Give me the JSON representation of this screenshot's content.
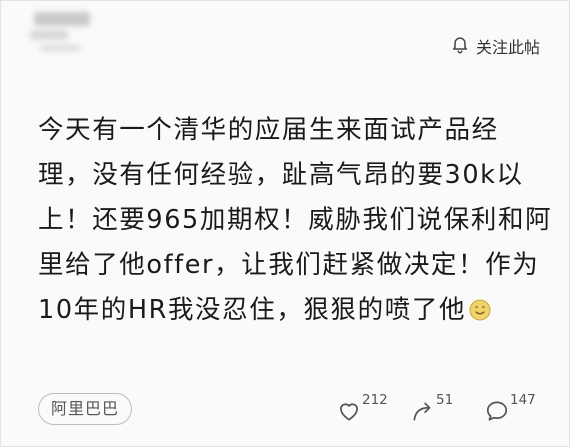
{
  "header": {
    "follow_label": "关注此帖"
  },
  "post": {
    "lines": [
      "今天有一个清华的应届生来面试产品经",
      "理，没有任何经验，趾高气昂的要30k以",
      "上！还要965加期权！威胁我们说保利和阿",
      "里给了他offer，让我们赶紧做决定！作为",
      "10年的HR我没忍住，狠狠的喷了他"
    ],
    "trailing_emoji": "smiling-face-emoji"
  },
  "footer": {
    "tag_label": "阿里巴巴",
    "like_count": "212",
    "repost_count": "51",
    "comment_count": "147"
  },
  "colors": {
    "background": "#fafafa",
    "text": "#1a1a1a",
    "muted": "#555555",
    "emoji_fill": "#f2d36b"
  },
  "icons": [
    "bell-icon",
    "heart-icon",
    "repost-icon",
    "comment-icon",
    "smiling-face-emoji"
  ]
}
